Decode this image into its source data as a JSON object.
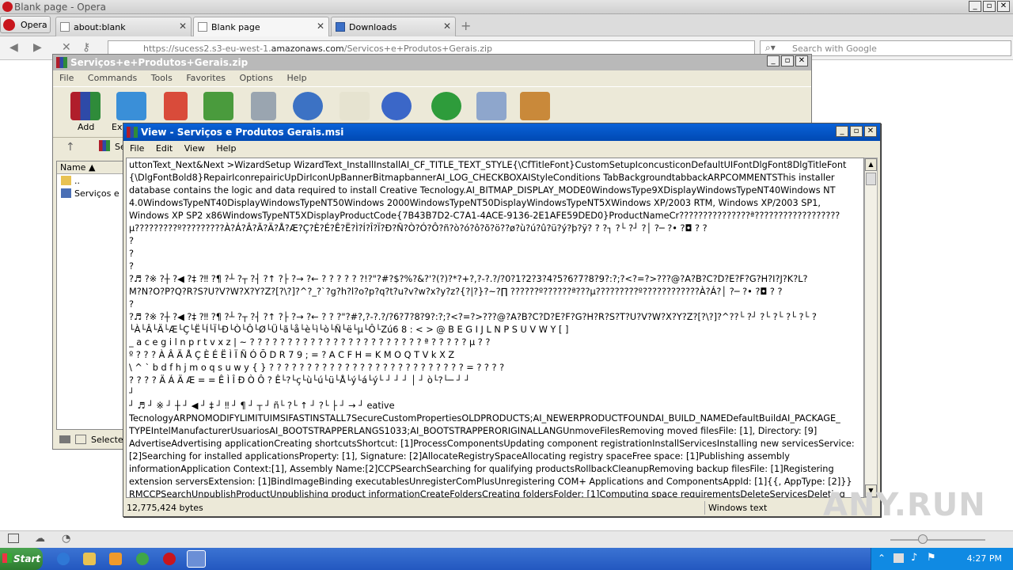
{
  "opera": {
    "title": "Blank page - Opera",
    "menu_label": "Opera",
    "tabs": [
      {
        "label": "about:blank"
      },
      {
        "label": "Blank page"
      },
      {
        "label": "Downloads"
      }
    ],
    "address": {
      "prefix": "https://sucess2.s3-eu-west-1.",
      "domain": "amazonaws.com",
      "suffix": "/Servicos+e+Produtos+Gerais.zip"
    },
    "search_placeholder": "Search with Google"
  },
  "winrar": {
    "title": "Serviços+e+Produtos+Gerais.zip",
    "menu": [
      "File",
      "Commands",
      "Tools",
      "Favorites",
      "Options",
      "Help"
    ],
    "toolbar": {
      "add": "Add",
      "extract": "Ext"
    },
    "addr_fragment": "Se",
    "list": {
      "header": "Name",
      "rows": [
        "..",
        "Serviços e Pr"
      ]
    },
    "status": "Selected"
  },
  "viewer": {
    "title": "View - Serviços e Produtos Gerais.msi",
    "menu": [
      "File",
      "Edit",
      "View",
      "Help"
    ],
    "lines": [
      "uttonText_Next&Next >WizardSetup WizardText_InstallInstallAI_CF_TITLE_TEXT_STYLE{\\CfTitleFont}CustomSetupIconcusticonDefaultUIFontDlgFont8DlgTitleFont",
      "{\\DlgFontBold8}RepairIconrepairicUpDirIconUpBannerBitmapbannerAI_LOG_CHECKBOXAIStyleConditions TabBackgroundtabbackARPCOMMENTSThis installer",
      "database contains the logic and data required to install Creative Tecnology.AI_BITMAP_DISPLAY_MODE0WindowsType9XDisplayWindowsTypeNT40Windows NT",
      "4.0WindowsTypeNT40DisplayWindowsTypeNT50Windows 2000WindowsTypeNT50DisplayWindowsTypeNT5XWindows XP/2003 RTM, Windows XP/2003 SP1,",
      "Windows XP SP2 x86WindowsTypeNT5XDisplayProductCode{7B43B7D2-C7A1-4ACE-9136-2E1AFE59DED0}ProductNameCr???????????????ª??????????????????",
      "µ?????????º?????????À?Á?Â?Ã?Ä?Å?Æ?Ç?È?É?Ê?Ë?Ì?Í?Î?Ï?Ð?Ñ?Ò?Ó?Ô?ñ?ò?ó?ô?õ?ö??ø?ù?ú?û?ü?ý?þ?ÿ? ?   ?┐ ?└ ?┘ ?│ ?─ ?• ?◘  ?        ?",
      "?",
      "?",
      "?",
      "?♬ ?※ ?┼ ?◀ ?‡ ?‼ ?¶ ?┴ ?┬ ?┤ ?↑ ?├ ?→ ?← ?  ?  ?  ?  ? ?!?\"?#?$?%?&?'?(?)?*?+?,?-?.?/?0?1?2?3?4?5?6?7?8?9?:?;?<?=?>???@?A?B?C?D?E?F?G?H?I?J?K?L?",
      "M?N?O?P?Q?R?S?U?V?W?X?Y?Z?[?\\?]?^?_?`?g?h?l?o?p?q?t?u?v?w?x?y?z?{?|?}?~?∏ ??????º??????ª???µ?????????º????????????À?Á?│ ?─ ?• ?◘ ?        ?",
      "?",
      "?♬ ?※ ?┼ ?◀ ?‡ ?‼ ?¶ ?┴ ?┬ ?┤ ?↑ ?├ ?→ ?← ?  ?  ?\"?#?,?-?.?/?6?7?8?9?:?;?<?=?>???@?A?B?C?D?E?F?G?H?R?S?T?U?V?W?X?Y?Z?[?\\?]?^??└ ?┘ ?└   ?└ ?└   ?└ ?",
      " └À└Â└Ä└Æ└Ç└Ë└Í└Ï└Ð└Ò└Ô└Ø└Ü└ã└å└è└ì└ò└Ñ└ë└µ└Ô└Zú6  8  :  <  >  @  B  E  G  I  J  L  N  P  S  U  V  W  Y  [  ]",
      "  _  a  c  e  g  i  l  n  p  r  t  v  x  z  |  ~  ?  ?  ?  ?  ?  ?  ?  ?  ?  ?  ?  ?  ?  ?  ?  ?  ?  ?  ?  ?  ?  ?  ?  ª  ?  ?  ?  ?  ?  µ  ?  ?",
      "  º  ?  ?  ?  À  Â  Ä  Å  Ç  È  É  Ë  Ì  Ï  Ñ  Ó  Õ  D  R  7  9  ;  =  ?  A  C  F  H  =  K  M  O  Q  T  V  k  X  Z",
      "\\  ^  `  b  d  f  h  j  m  o  q  s  u  w  y  {  }     ?  ?  ?  ?  ?  ?  ?  ?  ?  ?  ?  ?  ?  ?  ?  ?  ?  ?  ?  ?  ?  ?  ?  ?  ?  ?  =  ?  ?  ?  ?",
      "  ?  ?  ?  ?  Ä  Á  Ä  Æ  =  =  Ê  Ì  Î  Ð  Ò  Ô  ?                          Ê└?└ç└ù└ú└ü└Å└ý└á└ý└    ┘  ┘  ┘  │ ┘ ò└?└─ ┘          ┘",
      "┘",
      "┘ ♬ ┘ ※ ┘ ┼ ┘ ◀ ┘ ‡ ┘ ‼ ┘ ¶ ┘ ┬ ┘ ñ└ ?└ ↑ ┘ ?└ ├ ┘ → ┘ eative",
      "TecnologyARPNOMODIFYLIMITUIMSIFASTINSTALL7SecureCustomPropertiesOLDPRODUCTS;AI_NEWERPRODUCTFOUNDAI_BUILD_NAMEDefaultBuildAI_PACKAGE_",
      "TYPEIntelManufacturerUsuariosAI_BOOTSTRAPPERLANGS1033;AI_BOOTSTRAPPERORIGINALLANGUnmoveFilesRemoving moved filesFile: [1], Directory: [9]",
      "AdvertiseAdvertising applicationCreating shortcutsShortcut: [1]ProcessComponentsUpdating component registrationInstallServicesInstalling new servicesService:",
      "[2]Searching for installed applicationsProperty: [1], Signature: [2]AllocateRegistrySpaceAllocating registry spaceFree space: [1]Publishing assembly",
      "informationApplication Context:[1], Assembly Name:[2]CCPSearchSearching for qualifying productsRollbackCleanupRemoving backup filesFile: [1]Registering",
      "extension serversExtension: [1]BindImageBinding executablesUnregisterComPlusUnregistering COM+ Applications and ComponentsAppId: [1]{{, AppType: [2]}}",
      "RMCCPSearchUnpublishProductUnpublishing product informationCreateFoldersCreating foldersFolder: [1]Computing space requirementsDeleteServicesDeleting"
    ],
    "status_size": "12,775,424 bytes",
    "status_mode": "Windows text"
  },
  "taskbar": {
    "start_label": "Start",
    "clock": "4:27 PM"
  },
  "watermark": "ANY.RUN"
}
